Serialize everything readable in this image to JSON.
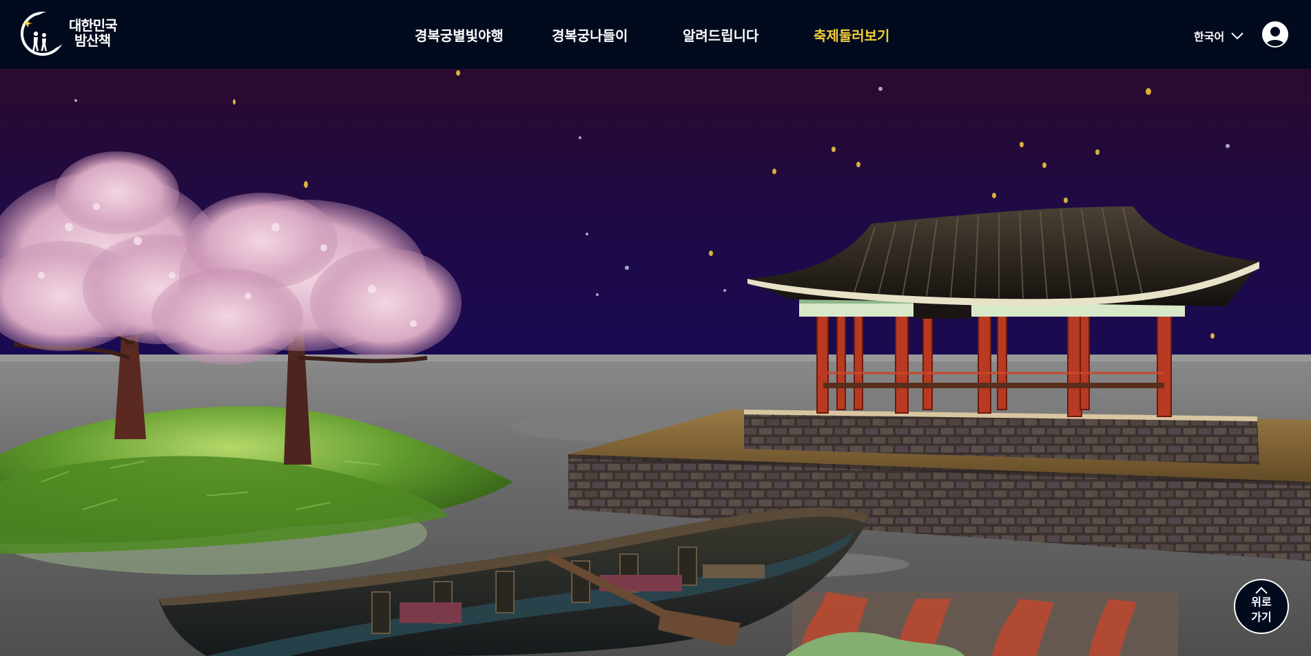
{
  "header": {
    "logo_line1": "대한민국",
    "logo_line2": "밤산책",
    "nav": [
      {
        "label": "경복궁별빛야행"
      },
      {
        "label": "경복궁나들이"
      },
      {
        "label": "알려드립니다"
      },
      {
        "label": "축제둘러보기"
      }
    ],
    "active_nav": "축제둘러보기",
    "language": "한국어"
  },
  "scroll_top": {
    "line1": "위로",
    "line2": "가기"
  },
  "colors": {
    "header_bg": "#020b1d",
    "active_accent": "#f5cf3c",
    "sky_top": "#2a0a2e",
    "sky_bottom": "#1a0a52"
  },
  "icons": {
    "language_dropdown": "chevron-down-icon",
    "user": "user-icon",
    "scroll_top": "chevron-up-icon"
  }
}
